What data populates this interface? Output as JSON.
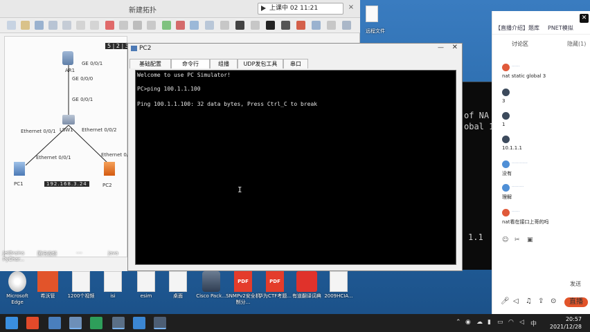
{
  "app": {
    "title": "新建拓扑",
    "recording": "上课中 02 11:21",
    "canvas_tag": "5 | 2 | 3",
    "ip_strip": "192.168.3.24"
  },
  "topology": {
    "ar1": "AR1",
    "ge001_top": "GE 0/0/1",
    "ge000": "GE 0/0/0",
    "ge001_mid": "GE 0/0/1",
    "lsw1": "LSW1",
    "eth002_left": "Ethernet 0/0/1",
    "eth002_right": "Ethernet 0/0/2",
    "eth001_pc1": "Ethernet 0/0/1",
    "eth001_pc2": "Ethernet 0/0/1",
    "pc1": "PC1",
    "pc2": "PC2"
  },
  "pc_window": {
    "title": "PC2",
    "tabs": [
      "基础配置",
      "命令行",
      "组播",
      "UDP发包工具",
      "串口"
    ],
    "terminal_lines": [
      "Welcome to use PC Simulator!",
      "",
      "PC>ping 100.1.1.100",
      "",
      "Ping 100.1.1.100: 32 data bytes, Press Ctrl_C to break"
    ]
  },
  "bg_window": {
    "line1": "of NA",
    "line2": "obal 1",
    "line3": "1.1"
  },
  "chat": {
    "tabs": [
      "【直播介绍】",
      "题库",
      "PNET模拟"
    ],
    "section_title": "讨论区",
    "section_link": "隐藏(1)",
    "messages": [
      {
        "name": "······",
        "text": "nat static global 3",
        "color": "#e05a3a"
      },
      {
        "name": "",
        "text": "3",
        "color": "#3c4a5c"
      },
      {
        "name": "",
        "text": "1",
        "color": "#3c4a5c"
      },
      {
        "name": "",
        "text": "10.1.1.1",
        "color": "#3c4a5c"
      },
      {
        "name": "············",
        "text": "没有",
        "color": "#4f8fd6"
      },
      {
        "name": "·········",
        "text": "理解",
        "color": "#4f8fd6"
      },
      {
        "name": "······",
        "text": "nat看在接口上哥的吗",
        "color": "#e05a3a"
      }
    ],
    "send_label": "发送",
    "live_label": "直播"
  },
  "desktop": {
    "top_labels": [
      "JetBrains PyChar...",
      "腾讯视频",
      "····",
      "java"
    ],
    "icons": [
      {
        "label": "Microsoft Edge",
        "kind": "edge"
      },
      {
        "label": "希沃管",
        "kind": "app"
      },
      {
        "label": "1200个视频",
        "kind": "file"
      },
      {
        "label": "isi",
        "kind": "file"
      },
      {
        "label": "esim",
        "kind": "file"
      },
      {
        "label": "桌面",
        "kind": "file"
      },
      {
        "label": "Cisco Pack...",
        "kind": "app"
      },
      {
        "label": "SNMPv2安全机制分...",
        "kind": "pdf"
      },
      {
        "label": "华为CTF考题...",
        "kind": "pdf"
      },
      {
        "label": "有道翻译词典",
        "kind": "youdao"
      },
      {
        "label": "2009HCIA...",
        "kind": "file"
      }
    ],
    "notice_text": "远程文件"
  },
  "taskbar": {
    "time": "20:57",
    "date": "2021/12/28"
  }
}
